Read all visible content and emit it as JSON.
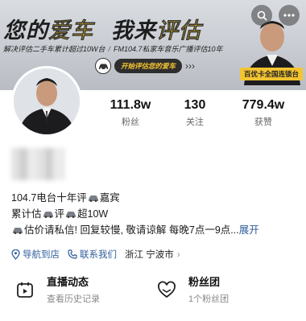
{
  "banner": {
    "title_part1": "您的",
    "title_part2": "爱车",
    "title_part3": "我来",
    "title_part4": "评估",
    "caption_left": "解决评估二手车累计超过10W台",
    "caption_right": "FM104.7私家车音乐广播评估10年",
    "slogan": "开始评估您的爱车",
    "tag": "百优卡全国连锁台"
  },
  "stats": {
    "followers": {
      "value": "111.8w",
      "label": "粉丝"
    },
    "following": {
      "value": "130",
      "label": "关注"
    },
    "likes": {
      "value": "779.4w",
      "label": "获赞"
    }
  },
  "bio": {
    "line1_a": "104.7电台十年评",
    "line1_b": "嘉宾",
    "line2_a": "累计估",
    "line2_b": "评",
    "line2_c": "超10W",
    "line3_a": "估价请私信! 回复较慢, 敬请谅解 每晚7点一9点...",
    "expand": "展开"
  },
  "info": {
    "navigate": "导航到店",
    "contact": "联系我们",
    "location": "浙江 宁波市"
  },
  "features": {
    "live": {
      "title": "直播动态",
      "sub": "查看历史记录"
    },
    "fans": {
      "title": "粉丝团",
      "sub": "1个粉丝团"
    }
  },
  "colors": {
    "link": "#2f5e9b",
    "banner_accent": "#f1c40f",
    "slogan_bg": "#2e2e2e"
  },
  "icons": [
    "search-icon",
    "more-icon",
    "location-pin-icon",
    "phone-icon",
    "chevron-right-icon",
    "calendar-play-icon",
    "heart-group-icon",
    "car-icon"
  ]
}
